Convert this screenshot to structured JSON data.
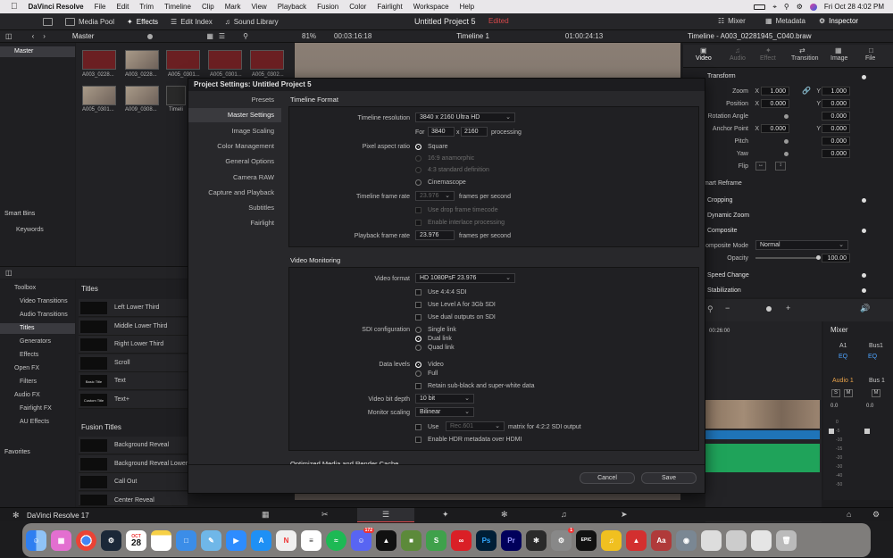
{
  "menubar": {
    "app_name": "DaVinci Resolve",
    "items": [
      "File",
      "Edit",
      "Trim",
      "Timeline",
      "Clip",
      "Mark",
      "View",
      "Playback",
      "Fusion",
      "Color",
      "Fairlight",
      "Workspace",
      "Help"
    ],
    "clock": "Fri Oct 28  4:02 PM"
  },
  "toolbar": {
    "media_pool": "Media Pool",
    "effects": "Effects",
    "edit_index": "Edit Index",
    "sound_library": "Sound Library",
    "project_title": "Untitled Project 5",
    "edited": "Edited",
    "mixer": "Mixer",
    "metadata": "Metadata",
    "inspector": "Inspector"
  },
  "subbar": {
    "bin": "Master",
    "zoom": "81%",
    "timecode": "00:03:16:18",
    "timeline": "Timeline 1",
    "timeline_tc": "01:00:24:13",
    "inspector_clip": "Timeline - A003_02281945_C040.braw"
  },
  "media_pool": {
    "master": "Master",
    "clips": [
      "A003_0228...",
      "A003_0228...",
      "A005_0301...",
      "A005_0301...",
      "A005_0302...",
      "A005_0301...",
      "A009_0308...",
      "Timeli"
    ],
    "smart_bins": "Smart Bins",
    "keywords": "Keywords"
  },
  "effects": {
    "tree": [
      "Toolbox",
      "Video Transitions",
      "Audio Transitions",
      "Titles",
      "Generators",
      "Effects",
      "Open FX",
      "Filters",
      "Audio FX",
      "Fairlight FX",
      "AU Effects"
    ],
    "favorites": "Favorites",
    "titles_header": "Titles",
    "titles": [
      {
        "thumb": "",
        "label": "Left Lower Third"
      },
      {
        "thumb": "",
        "label": "Middle Lower Third"
      },
      {
        "thumb": "",
        "label": "Right Lower Third"
      },
      {
        "thumb": "",
        "label": "Scroll"
      },
      {
        "thumb": "Basic Title",
        "label": "Text"
      },
      {
        "thumb": "Custom Title",
        "label": "Text+"
      }
    ],
    "fusion_header": "Fusion Titles",
    "fusion_titles": [
      "Background Reveal",
      "Background Reveal Lower Th",
      "Call Out",
      "Center Reveal"
    ]
  },
  "inspector": {
    "tabs": [
      "Video",
      "Audio",
      "Effect",
      "Transition",
      "Image",
      "File"
    ],
    "transform": "Transform",
    "zoom_label": "Zoom",
    "zoom_x": "1.000",
    "zoom_y": "1.000",
    "position_label": "Position",
    "position_x": "0.000",
    "position_y": "0.000",
    "rotation_label": "Rotation Angle",
    "rotation": "0.000",
    "anchor_label": "Anchor Point",
    "anchor_x": "0.000",
    "anchor_y": "0.000",
    "pitch_label": "Pitch",
    "pitch": "0.000",
    "yaw_label": "Yaw",
    "yaw": "0.000",
    "flip_label": "Flip",
    "smart_reframe": "mart Reframe",
    "cropping": "Cropping",
    "dynamic_zoom": "Dynamic Zoom",
    "composite": "Composite",
    "composite_mode_label": "omposite Mode",
    "composite_mode": "Normal",
    "opacity_label": "Opacity",
    "opacity": "100.00",
    "speed_change": "Speed Change",
    "stabilization": "Stabilization",
    "x": "X",
    "y": "Y"
  },
  "timeline": {
    "ruler": "00:26:00"
  },
  "mixer": {
    "title": "Mixer",
    "a1": "A1",
    "bus1": "Bus1",
    "eq": "EQ",
    "audio1": "Audio 1",
    "bus1b": "Bus 1",
    "s": "S",
    "m": "M",
    "db": [
      "0.0",
      "0.0"
    ],
    "scale": [
      "0",
      "-5",
      "-10",
      "-15",
      "-20",
      "-30",
      "-40",
      "-50"
    ]
  },
  "dialog": {
    "title": "Project Settings:  Untitled Project 5",
    "nav": [
      "Presets",
      "Master Settings",
      "Image Scaling",
      "Color Management",
      "General Options",
      "Camera RAW",
      "Capture and Playback",
      "Subtitles",
      "Fairlight"
    ],
    "timeline_format": "Timeline Format",
    "timeline_resolution_label": "Timeline resolution",
    "timeline_resolution": "3840 x 2160 Ultra HD",
    "for": "For",
    "res_w": "3840",
    "x": "x",
    "res_h": "2160",
    "processing": "processing",
    "pixel_aspect_label": "Pixel aspect ratio",
    "pixel_aspect_options": [
      "Square",
      "16:9 anamorphic",
      "4:3 standard definition",
      "Cinemascope"
    ],
    "frame_rate_label": "Timeline frame rate",
    "frame_rate": "23.976",
    "fps": "frames per second",
    "drop_frame": "Use drop frame timecode",
    "interlace": "Enable interlace processing",
    "playback_rate_label": "Playback frame rate",
    "playback_rate": "23.976",
    "video_monitoring": "Video Monitoring",
    "video_format_label": "Video format",
    "video_format": "HD 1080PsF 23.976",
    "use_444": "Use 4:4:4 SDI",
    "use_level_a": "Use Level A for 3Gb SDI",
    "use_dual": "Use dual outputs on SDI",
    "sdi_label": "SDI configuration",
    "sdi_options": [
      "Single link",
      "Dual link",
      "Quad link"
    ],
    "data_levels_label": "Data levels",
    "data_levels_options": [
      "Video",
      "Full"
    ],
    "retain": "Retain sub-black and super-white data",
    "bit_depth_label": "Video bit depth",
    "bit_depth": "10 bit",
    "scaling_label": "Monitor scaling",
    "scaling": "Bilinear",
    "use": "Use",
    "rec": "Rec.601",
    "matrix": "matrix for 4:2:2 SDI output",
    "hdr": "Enable HDR metadata over HDMI",
    "optimized": "Optimized Media and Render Cache",
    "cancel": "Cancel",
    "save": "Save"
  },
  "bottom": {
    "brand": "DaVinci Resolve 17"
  },
  "dock": {
    "calendar_month": "OCT",
    "calendar_day": "28",
    "discord_badge": "172",
    "badge_1": "1"
  },
  "colors": {
    "accent_red": "#d8484a",
    "select_bg": "#3a3a3e",
    "audio_green": "#1fa35a",
    "audio_blue": "#1f74b8"
  }
}
